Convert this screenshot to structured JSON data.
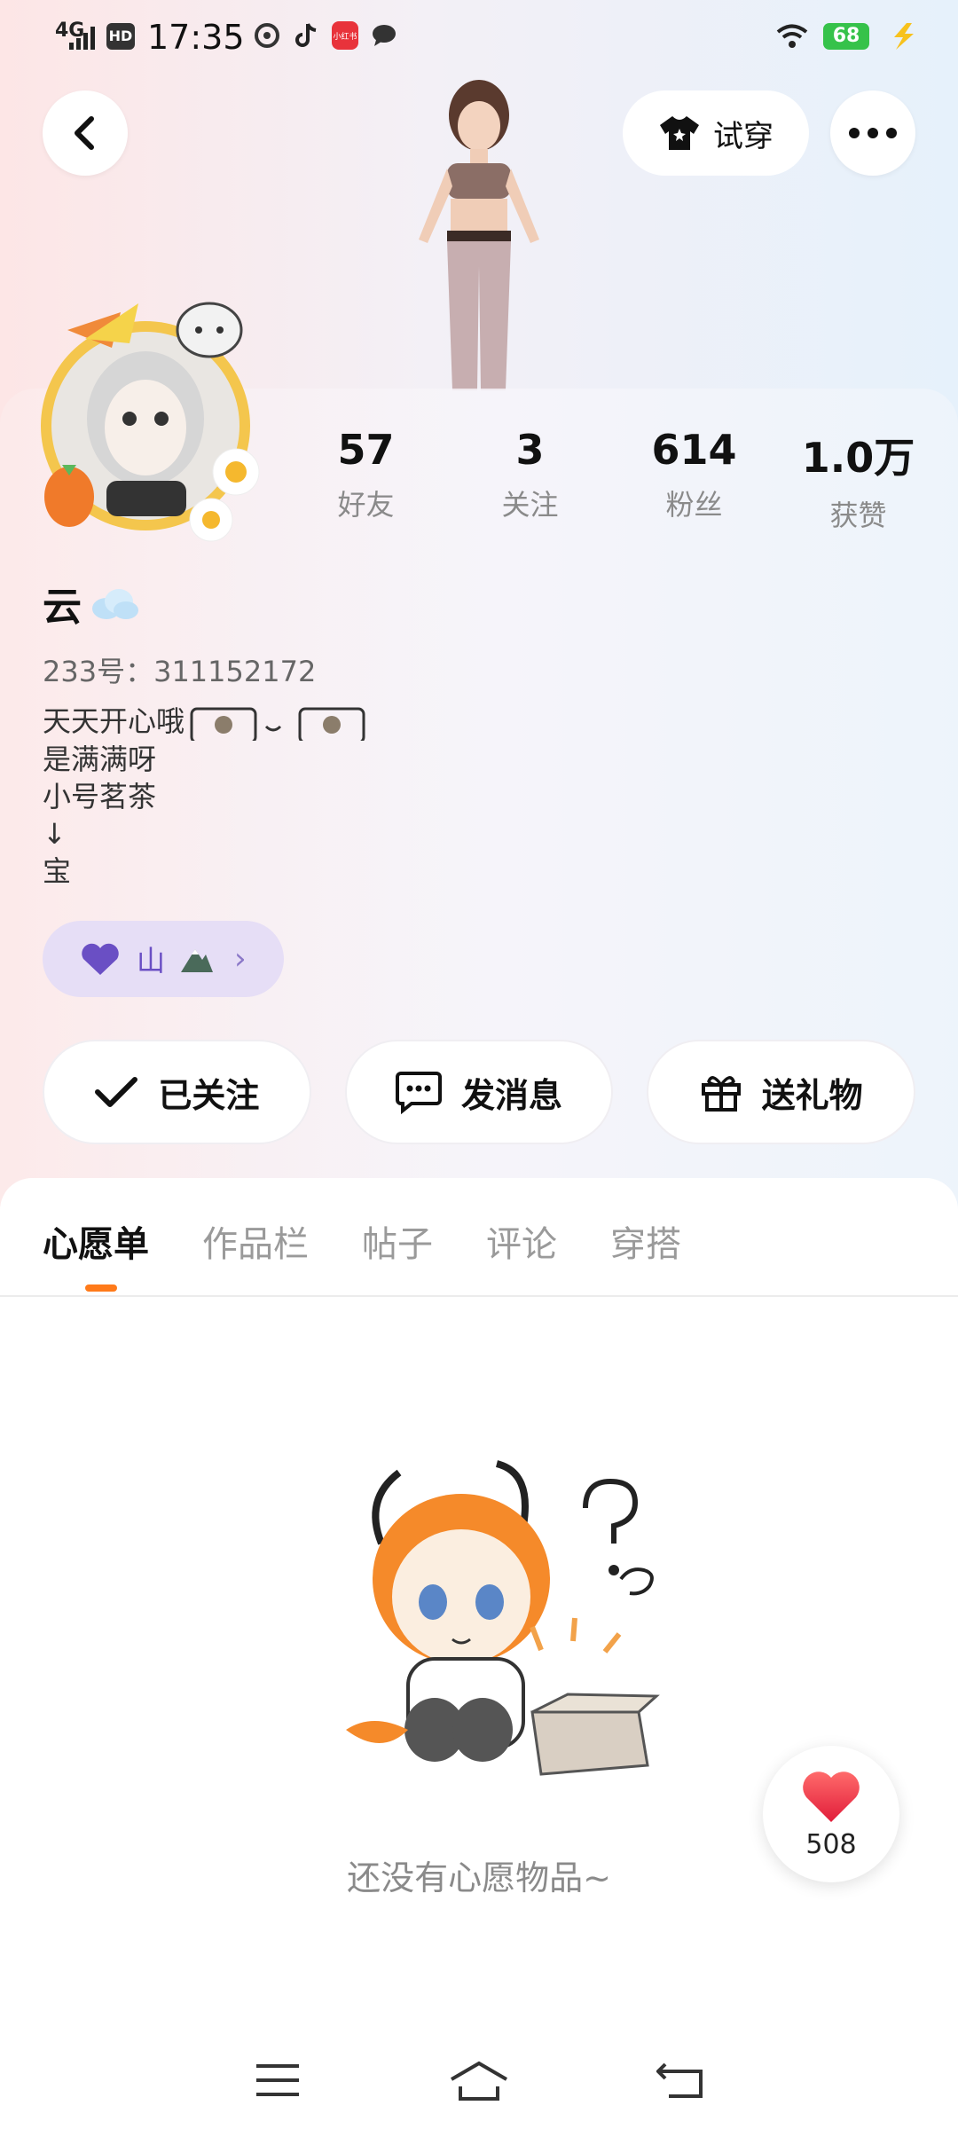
{
  "status_bar": {
    "network": "4G",
    "hd": "HD",
    "time": "17:35",
    "battery": "68",
    "app_icons": [
      "qq-browser-icon",
      "tiktok-icon",
      "xiaohongshu-icon",
      "message-icon"
    ],
    "xhs_label": "小红书"
  },
  "header": {
    "try_on_label": "试穿"
  },
  "stats": [
    {
      "value": "57",
      "label": "好友"
    },
    {
      "value": "3",
      "label": "关注"
    },
    {
      "value": "614",
      "label": "粉丝"
    },
    {
      "value": "1.0万",
      "label": "获赞"
    }
  ],
  "profile": {
    "name": "云",
    "id_text": "233号：311152172",
    "bio_lines": [
      "天天开心哦",
      "是满满呀",
      "小号茗茶",
      "↓",
      "宝"
    ],
    "tag_label": "山"
  },
  "actions": {
    "follow_label": "已关注",
    "message_label": "发消息",
    "gift_label": "送礼物"
  },
  "tabs": [
    "心愿单",
    "作品栏",
    "帖子",
    "评论",
    "穿搭"
  ],
  "active_tab": "心愿单",
  "empty_state": {
    "text": "还没有心愿物品~"
  },
  "like_fab": {
    "count": "508"
  },
  "colors": {
    "accent": "#ff7a1a",
    "tag_bg": "#e6def6",
    "battery": "#36c24a"
  }
}
